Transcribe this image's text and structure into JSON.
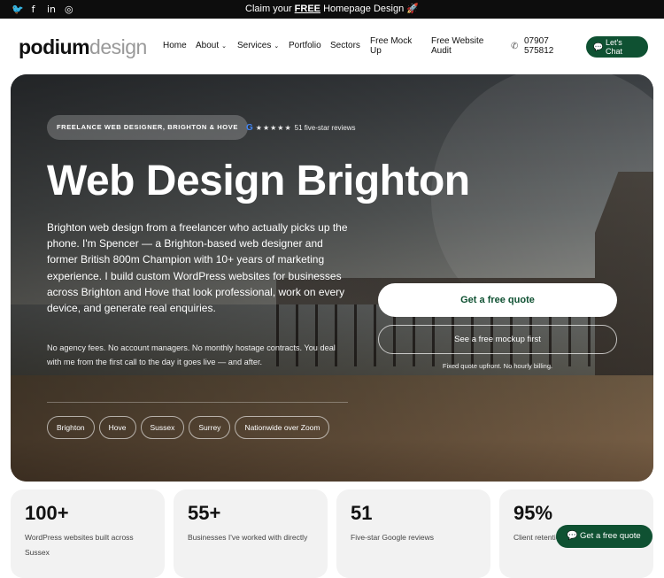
{
  "topbar": {
    "socials": [
      {
        "name": "twitter-icon",
        "glyph": "🐦"
      },
      {
        "name": "facebook-icon",
        "glyph": "f"
      },
      {
        "name": "linkedin-icon",
        "glyph": "in"
      },
      {
        "name": "instagram-icon",
        "glyph": "◎"
      }
    ],
    "promo_before": "Claim your ",
    "promo_free": "FREE",
    "promo_after": " Homepage Design 🚀"
  },
  "header": {
    "logo_a": "podium",
    "logo_b": "design",
    "nav": {
      "home": "Home",
      "about": "About",
      "services": "Services",
      "portfolio": "Portfolio",
      "sectors": "Sectors",
      "mockup_1": "Free Mock",
      "mockup_2": "Up",
      "audit_1": "Free Website",
      "audit_2": "Audit"
    },
    "phone_1": "07907",
    "phone_2": "575812",
    "chat_1": "Let's",
    "chat_2": "Chat"
  },
  "hero": {
    "tag": "FREELANCE WEB DESIGNER, BRIGHTON & HOVE",
    "reviews_g": "G",
    "reviews_stars": "★★★★★",
    "reviews_text": "51 five-star reviews",
    "title": "Web Design Brighton",
    "lead": "Brighton web design from a freelancer who actually picks up the phone. I'm Spencer — a Brighton-based web designer and former British 800m Champion with 10+ years of marketing experience. I build custom WordPress websites for businesses across Brighton and Hove that look professional, work on every device, and generate real enquiries.",
    "sub": "No agency fees. No account managers. No monthly hostage contracts. You deal with me from the first call to the day it goes live — and after.",
    "cta_primary": "Get a free quote",
    "cta_secondary": "See a free mockup first",
    "fine_print": "Fixed quote upfront. No hourly billing.",
    "chips": [
      "Brighton",
      "Hove",
      "Sussex",
      "Surrey",
      "Nationwide over Zoom"
    ]
  },
  "stats": [
    {
      "num": "100+",
      "desc": "WordPress websites built across Sussex"
    },
    {
      "num": "55+",
      "desc": "Businesses I've worked with directly"
    },
    {
      "num": "51",
      "desc": "Five-star Google reviews"
    },
    {
      "num": "95%",
      "desc": "Client retention rate afterwards"
    }
  ],
  "float_cta": "Get a free quote",
  "colors": {
    "brand_green": "#0f5132",
    "topbar": "#0d0d0d"
  }
}
